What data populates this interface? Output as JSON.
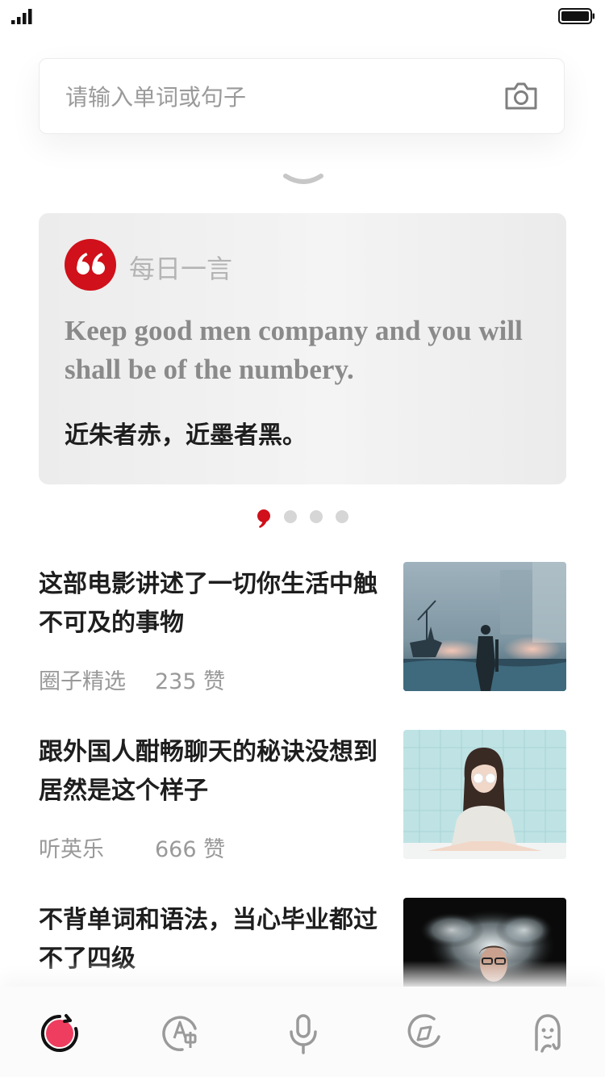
{
  "search": {
    "placeholder": "请输入单词或句子"
  },
  "daily_quote": {
    "heading": "每日一言",
    "english": "Keep good men company and you will shall be of the numbery.",
    "chinese": "近朱者赤，近墨者黑。",
    "accent_color": "#d0101a"
  },
  "carousel": {
    "page_count": 4,
    "active_index": 0
  },
  "articles": [
    {
      "title": "这部电影讲述了一切你生活中触不可及的事物",
      "source": "圈子精选",
      "likes": "235 赞",
      "image": "soldier-on-beach-image"
    },
    {
      "title": "跟外国人酣畅聊天的秘诀没想到居然是这个样子",
      "source": "听英乐",
      "likes": "666 赞",
      "image": "woman-with-glasses-image"
    },
    {
      "title": "不背单词和语法，当心毕业都过不了四级",
      "image": "man-in-powder-explosion-image"
    }
  ],
  "tabs": [
    {
      "name": "home",
      "icon": "record-icon",
      "active": true
    },
    {
      "name": "translate",
      "icon": "translate-icon"
    },
    {
      "name": "voice",
      "icon": "microphone-icon"
    },
    {
      "name": "discover",
      "icon": "compass-icon"
    },
    {
      "name": "profile",
      "icon": "ghost-icon"
    }
  ]
}
